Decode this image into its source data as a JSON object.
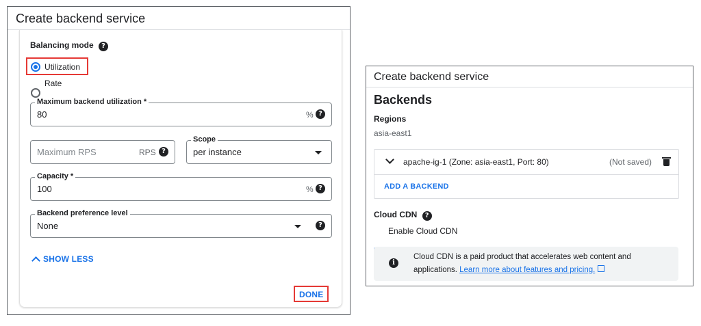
{
  "left_panel": {
    "title": "Create backend service",
    "balancing_mode_label": "Balancing mode",
    "radio_utilization": "Utilization",
    "radio_rate": "Rate",
    "max_util_label": "Maximum backend utilization *",
    "max_util_value": "80",
    "max_util_suffix": "%",
    "max_rps_placeholder": "Maximum RPS",
    "max_rps_suffix": "RPS",
    "scope_label": "Scope",
    "scope_value": "per instance",
    "capacity_label": "Capacity *",
    "capacity_value": "100",
    "capacity_suffix": "%",
    "pref_label": "Backend preference level",
    "pref_value": "None",
    "show_less": "SHOW LESS",
    "done": "DONE"
  },
  "right_panel": {
    "title": "Create backend service",
    "backends_heading": "Backends",
    "regions_label": "Regions",
    "region_value": "asia-east1",
    "backend_item": "apache-ig-1 (Zone: asia-east1, Port: 80)",
    "backend_status": "(Not saved)",
    "add_backend": "ADD A BACKEND",
    "cdn_label": "Cloud CDN",
    "enable_cdn": "Enable Cloud CDN",
    "info_text_1": "Cloud CDN is a paid product that accelerates web content and",
    "info_text_2": "applications.",
    "info_link": "Learn more about features and pricing."
  },
  "colors": {
    "accent": "#1a73e8",
    "highlight": "#e53935"
  }
}
